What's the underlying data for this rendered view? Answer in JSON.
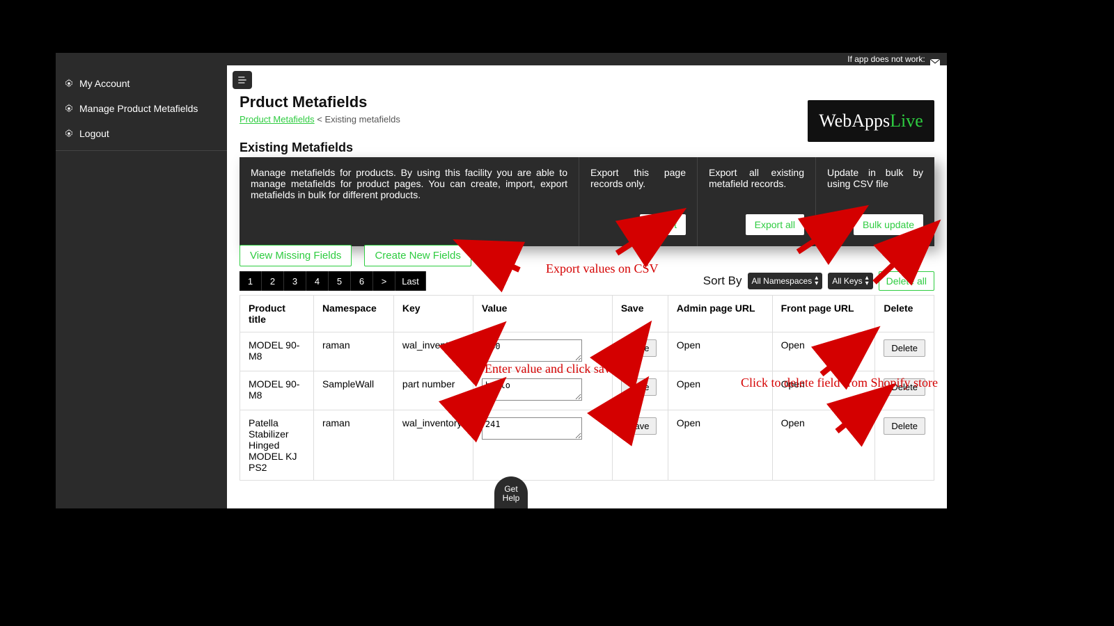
{
  "topbar": {
    "message": "If app does not work:"
  },
  "sidebar": {
    "items": [
      {
        "label": "My Account"
      },
      {
        "label": "Manage Product Metafields"
      },
      {
        "label": "Logout"
      }
    ]
  },
  "header": {
    "page_title": "Prduct Metafields",
    "breadcrumb_link": "Product Metafields",
    "breadcrumb_sep": " < ",
    "breadcrumb_current": "Existing metafields",
    "section_title": "Existing Metafields"
  },
  "logo": {
    "brand_a": "WebApps",
    "brand_b": "Live"
  },
  "panels": {
    "desc": "Manage metafields for products. By using this facility you are able to manage metafields for product pages. You can create, import, export metafields in bulk for different products.",
    "export_page_label": "Export this page records only.",
    "export_page_btn": "Export",
    "export_all_label": "Export all existing metafield records.",
    "export_all_btn": "Export all",
    "bulk_label": "Update in bulk by using CSV file",
    "bulk_btn": "Bulk update"
  },
  "actions": {
    "view_missing": "View Missing Fields",
    "create_new": "Create New Fields"
  },
  "pager": {
    "pages": [
      "1",
      "2",
      "3",
      "4",
      "5",
      "6",
      ">",
      "Last"
    ]
  },
  "sort": {
    "label": "Sort By",
    "ns_select": "All Namespaces",
    "key_select": "All Keys",
    "delete_all": "Delete all"
  },
  "table": {
    "headers": {
      "title": "Product title",
      "namespace": "Namespace",
      "key": "Key",
      "value": "Value",
      "save": "Save",
      "admin": "Admin page URL",
      "front": "Front page URL",
      "delete": "Delete"
    },
    "rows": [
      {
        "title": "MODEL 90-M8",
        "namespace": "raman",
        "key": "wal_inventory",
        "value": "240",
        "save": "Save",
        "admin": "Open",
        "front": "Open",
        "delete": "Delete"
      },
      {
        "title": "MODEL 90-M8",
        "namespace": "SampleWall",
        "key": "part number",
        "value": "hello",
        "save": "Save",
        "admin": "Open",
        "front": "Open",
        "delete": "Delete"
      },
      {
        "title": "Patella Stabilizer Hinged MODEL KJ PS2",
        "namespace": "raman",
        "key": "wal_inventory",
        "value": "241",
        "save": "Save",
        "admin": "Open",
        "front": "Open",
        "delete": "Delete"
      }
    ]
  },
  "help": {
    "line1": "Get",
    "line2": "Help"
  },
  "annotations": {
    "export_csv": "Export values on CSV",
    "enter_save": "Enter value and click save",
    "delete_field": "Click to delete field from Shopify store"
  }
}
